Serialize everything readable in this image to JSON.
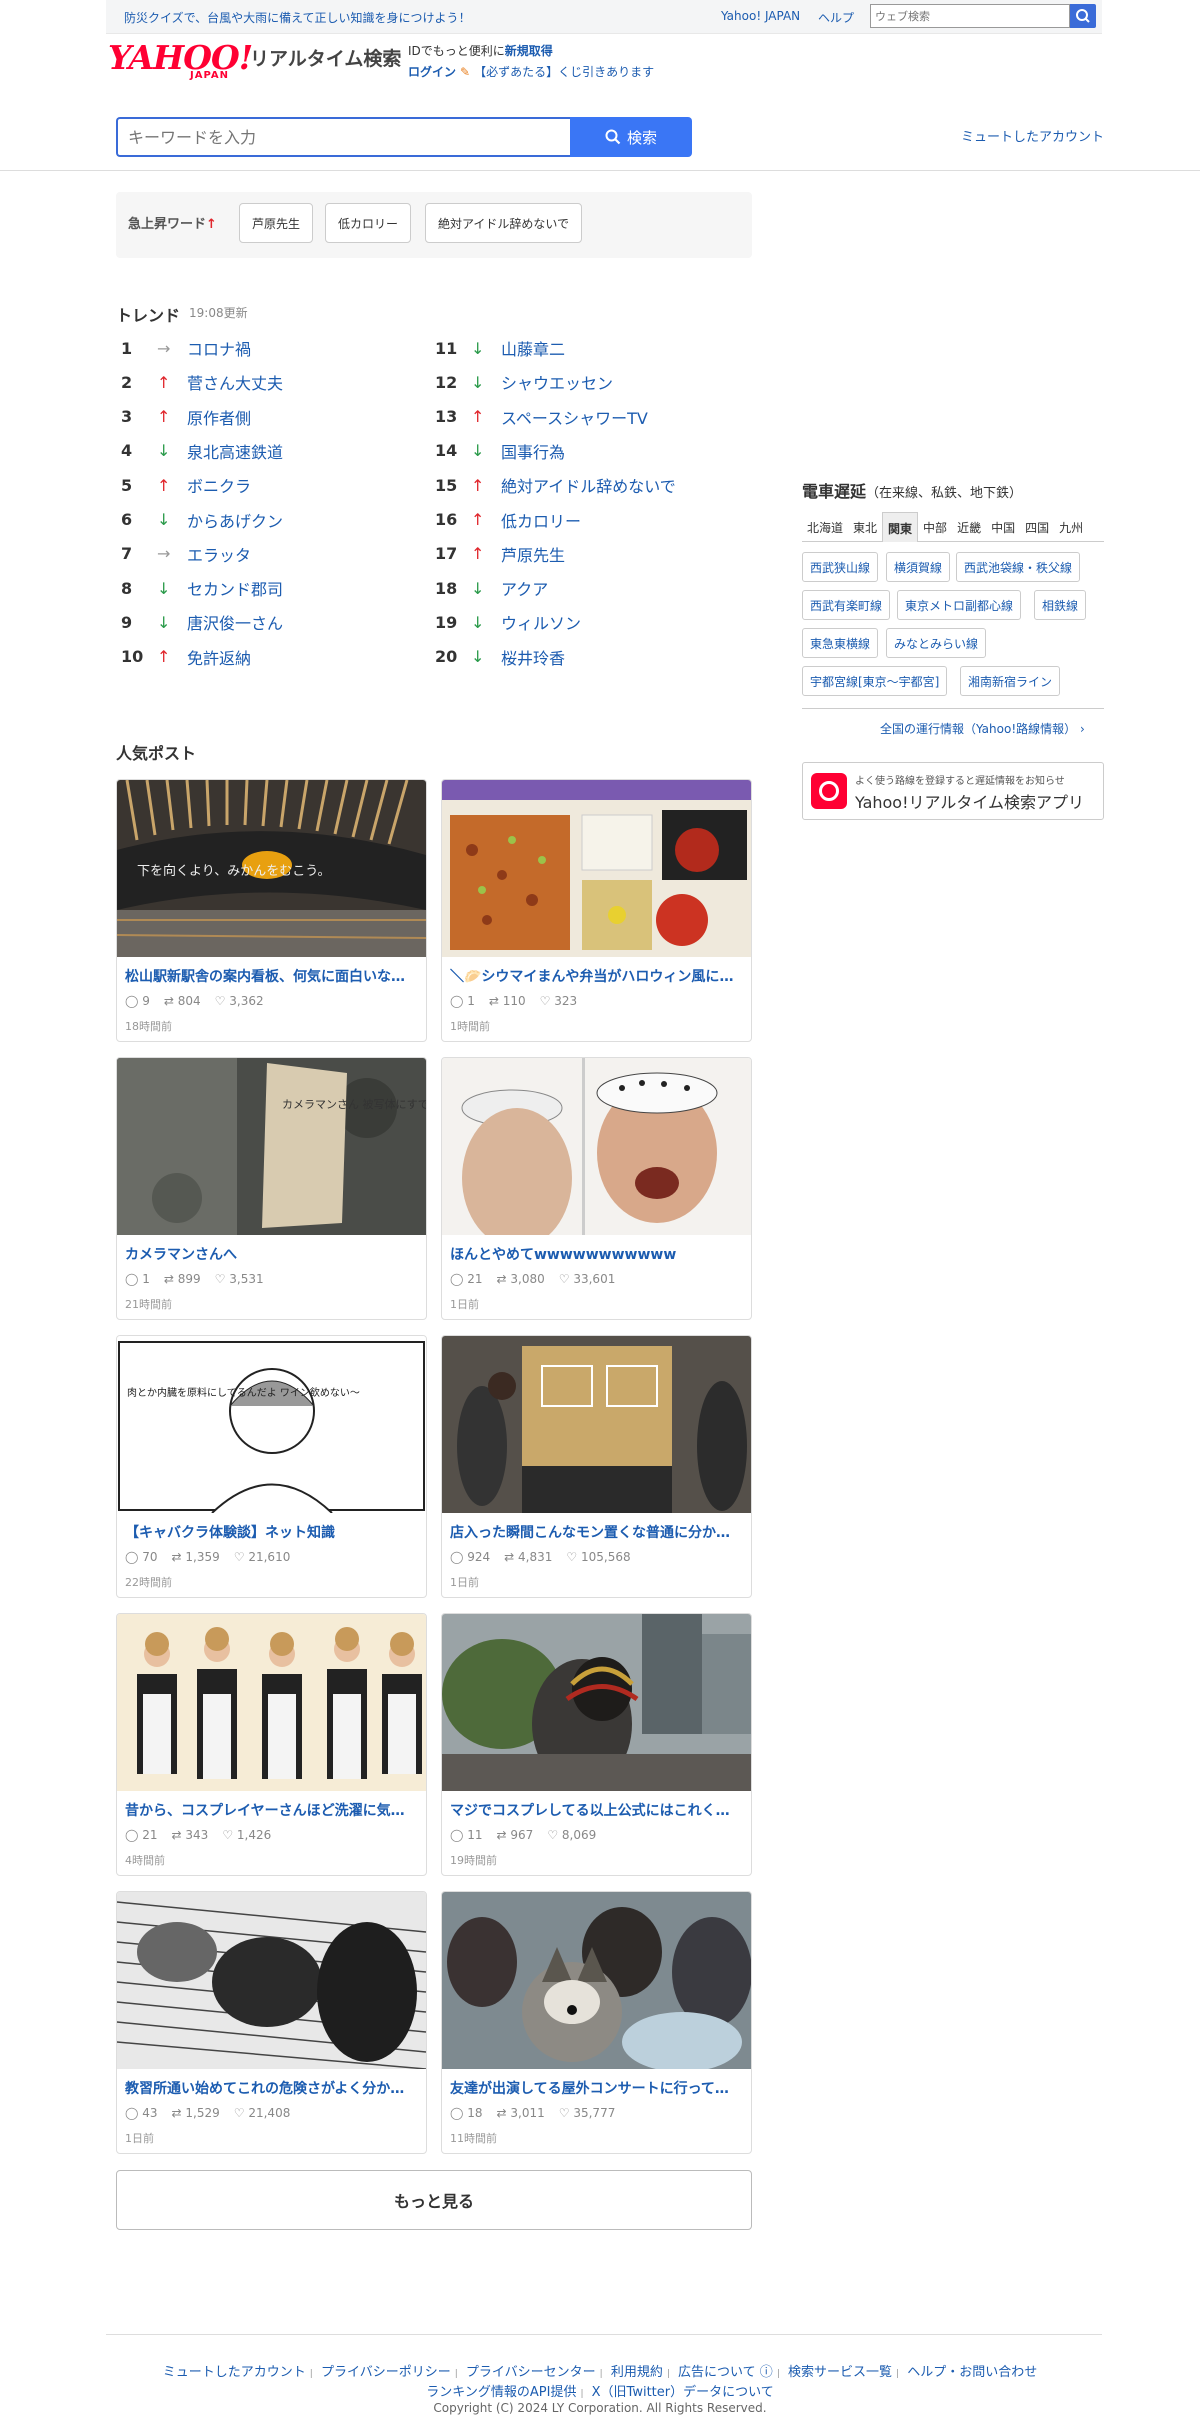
{
  "topbar": {
    "notice": "防災クイズで、台風や大雨に備えて正しい知識を身につけよう！",
    "yahoo_japan": "Yahoo! JAPAN",
    "help": "ヘルプ",
    "websearch_placeholder": "ウェブ検索"
  },
  "header": {
    "logo_main": "YAHOO!",
    "logo_sub": "JAPAN",
    "title": "リアルタイム検索",
    "id_prefix": "IDでもっと便利に",
    "id_register": "新規取得",
    "login": "ログイン",
    "lottery": "【必ずあたる】くじ引きあります"
  },
  "search": {
    "placeholder": "キーワードを入力",
    "button": "検索",
    "muted_accounts": "ミュートしたアカウント"
  },
  "rising": {
    "label": "急上昇ワード",
    "words": [
      "芦原先生",
      "低カロリー",
      "絶対アイドル辞めないで"
    ]
  },
  "trend": {
    "title": "トレンド",
    "updated": "19:08更新",
    "items": [
      {
        "rank": "1",
        "dir": "same",
        "word": "コロナ禍"
      },
      {
        "rank": "2",
        "dir": "up",
        "word": "菅さん大丈夫"
      },
      {
        "rank": "3",
        "dir": "up",
        "word": "原作者側"
      },
      {
        "rank": "4",
        "dir": "down",
        "word": "泉北高速鉄道"
      },
      {
        "rank": "5",
        "dir": "up",
        "word": "ボニクラ"
      },
      {
        "rank": "6",
        "dir": "down",
        "word": "からあげクン"
      },
      {
        "rank": "7",
        "dir": "same",
        "word": "エラッタ"
      },
      {
        "rank": "8",
        "dir": "down",
        "word": "セカンド郡司"
      },
      {
        "rank": "9",
        "dir": "down",
        "word": "唐沢俊一さん"
      },
      {
        "rank": "10",
        "dir": "up",
        "word": "免許返納"
      },
      {
        "rank": "11",
        "dir": "down",
        "word": "山藤章二"
      },
      {
        "rank": "12",
        "dir": "down",
        "word": "シャウエッセン"
      },
      {
        "rank": "13",
        "dir": "up",
        "word": "スペースシャワーTV"
      },
      {
        "rank": "14",
        "dir": "down",
        "word": "国事行為"
      },
      {
        "rank": "15",
        "dir": "up",
        "word": "絶対アイドル辞めないで"
      },
      {
        "rank": "16",
        "dir": "up",
        "word": "低カロリー"
      },
      {
        "rank": "17",
        "dir": "up",
        "word": "芦原先生"
      },
      {
        "rank": "18",
        "dir": "down",
        "word": "アクア"
      },
      {
        "rank": "19",
        "dir": "down",
        "word": "ウィルソン"
      },
      {
        "rank": "20",
        "dir": "down",
        "word": "桜井玲香"
      }
    ]
  },
  "posts": {
    "title": "人気ポスト",
    "items": [
      {
        "title": "松山駅新駅舎の案内看板、何気に面白いな…",
        "replies": "9",
        "reposts": "804",
        "likes": "3,362",
        "ago": "18時間前",
        "image_text": "下を向くより、みかんをむこう。"
      },
      {
        "title": "＼🥟シウマイまんや弁当がハロウィン風に仮…",
        "replies": "1",
        "reposts": "110",
        "likes": "323",
        "ago": "1時間前",
        "image_text": ""
      },
      {
        "title": "カメラマンさんへ",
        "replies": "1",
        "reposts": "899",
        "likes": "3,531",
        "ago": "21時間前",
        "image_text": "カメラマンさん 被写体にすではなく 足元の苔にも 御配慮下さい"
      },
      {
        "title": "ほんとやめてwwwwwwwwwww",
        "replies": "21",
        "reposts": "3,080",
        "likes": "33,601",
        "ago": "1日前",
        "image_text": ""
      },
      {
        "title": "【キャバクラ体験談】ネット知識",
        "replies": "70",
        "reposts": "1,359",
        "likes": "21,610",
        "ago": "22時間前",
        "image_text": "肉とか内臓を原料にしてるんだよ ワイン飲めない〜"
      },
      {
        "title": "店入った瞬間こんなモン置くな普通に分か…",
        "replies": "924",
        "reposts": "4,831",
        "likes": "105,568",
        "ago": "1日前",
        "image_text": ""
      },
      {
        "title": "昔から、コスプレイヤーさんほど洗濯に気…",
        "replies": "21",
        "reposts": "343",
        "likes": "1,426",
        "ago": "4時間前",
        "image_text": ""
      },
      {
        "title": "マジでコスプレしてる以上公式にはこれく…",
        "replies": "11",
        "reposts": "967",
        "likes": "8,069",
        "ago": "19時間前",
        "image_text": ""
      },
      {
        "title": "教習所通い始めてこれの危険さがよく分か…",
        "replies": "43",
        "reposts": "1,529",
        "likes": "21,408",
        "ago": "1日前",
        "image_text": ""
      },
      {
        "title": "友達が出演してる屋外コンサートに行って…",
        "replies": "18",
        "reposts": "3,011",
        "likes": "35,777",
        "ago": "11時間前",
        "image_text": ""
      }
    ],
    "more": "もっと見る"
  },
  "train": {
    "title": "電車遅延",
    "subtitle": "（在来線、私鉄、地下鉄）",
    "regions": [
      "北海道",
      "東北",
      "関東",
      "中部",
      "近畿",
      "中国",
      "四国",
      "九州"
    ],
    "active_region": "関東",
    "lines": [
      "西武狭山線",
      "横須賀線",
      "西武池袋線・秩父線",
      "西武有楽町線",
      "東京メトロ副都心線",
      "相鉄線",
      "東急東横線",
      "みなとみらい線",
      "宇都宮線[東京〜宇都宮]",
      "湘南新宿ライン"
    ],
    "all_link": "全国の運行情報（Yahoo!路線情報）"
  },
  "app": {
    "sub": "よく使う路線を登録すると遅延情報をお知らせ",
    "name": "Yahoo!リアルタイム検索アプリ"
  },
  "footer": {
    "links": [
      "ミュートしたアカウント",
      "プライバシーポリシー",
      "プライバシーセンター",
      "利用規約",
      "広告について",
      "検索サービス一覧",
      "ヘルプ・お問い合わせ"
    ],
    "links2": [
      "ランキング情報のAPI提供",
      "X（旧Twitter）データについて"
    ],
    "copyright": "Copyright (C) 2024 LY Corporation. All Rights Reserved."
  },
  "colors": {
    "accent": "#3a76f5",
    "brand": "#ff0033",
    "link": "#1c5cb0",
    "up": "#e0262c",
    "down": "#2a9a4a"
  }
}
